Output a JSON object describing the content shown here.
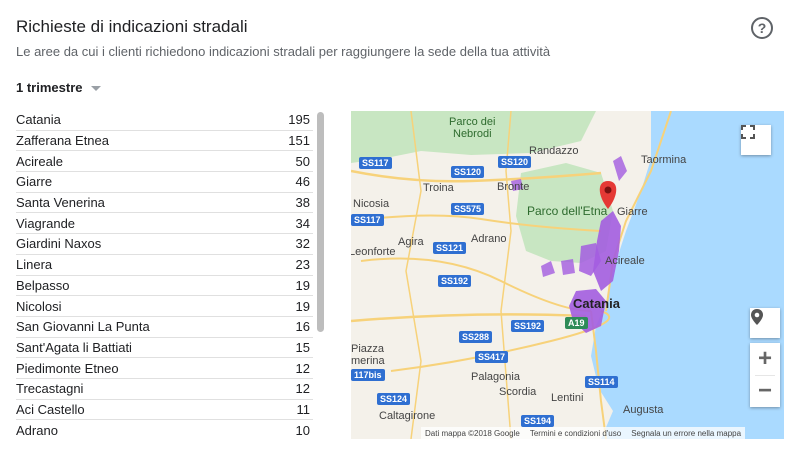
{
  "header": {
    "title": "Richieste di indicazioni stradali",
    "subtitle": "Le aree da cui i clienti richiedono indicazioni stradali per raggiungere la sede della tua attività",
    "help_icon": "?"
  },
  "filter": {
    "period_label": "1 trimestre"
  },
  "locations": [
    {
      "name": "Catania",
      "count": "195"
    },
    {
      "name": "Zafferana Etnea",
      "count": "151"
    },
    {
      "name": "Acireale",
      "count": "50"
    },
    {
      "name": "Giarre",
      "count": "46"
    },
    {
      "name": "Santa Venerina",
      "count": "38"
    },
    {
      "name": "Viagrande",
      "count": "34"
    },
    {
      "name": "Giardini Naxos",
      "count": "32"
    },
    {
      "name": "Linera",
      "count": "23"
    },
    {
      "name": "Belpasso",
      "count": "19"
    },
    {
      "name": "Nicolosi",
      "count": "19"
    },
    {
      "name": "San Giovanni La Punta",
      "count": "16"
    },
    {
      "name": "Sant'Agata li Battiati",
      "count": "15"
    },
    {
      "name": "Piedimonte Etneo",
      "count": "12"
    },
    {
      "name": "Trecastagni",
      "count": "12"
    },
    {
      "name": "Aci Castello",
      "count": "11"
    },
    {
      "name": "Adrano",
      "count": "10"
    }
  ],
  "map": {
    "labels": {
      "parco_nebrodi": "Parco dei",
      "parco_nebrodi_2": "Nebrodi",
      "randazzo": "Randazzo",
      "taormina": "Taormina",
      "troina": "Troina",
      "bronte": "Bronte",
      "nicosia": "Nicosia",
      "parco_etna": "Parco dell'Etna",
      "giarre": "Giarre",
      "agira": "Agira",
      "adrano": "Adrano",
      "leonforte": "Leonforte",
      "acireale": "Acireale",
      "catania": "Catania",
      "piazza": "Piazza",
      "armerina": "merina",
      "palagonia": "Palagonia",
      "scordia": "Scordia",
      "lentini": "Lentini",
      "augusta": "Augusta",
      "caltagirone": "Caltagirone"
    },
    "roads": {
      "ss117": "SS117",
      "ss120a": "SS120",
      "ss120b": "SS120",
      "ss575": "SS575",
      "ss117b": "SS117",
      "ss121": "SS121",
      "ss192a": "SS192",
      "ss192b": "SS192",
      "ss288": "SS288",
      "ss417": "SS417",
      "ss117bis": "117bis",
      "ss124": "SS124",
      "ss114": "SS114",
      "ss194": "SS194",
      "a19": "A19"
    },
    "attribution": {
      "data": "Dati mappa ©2018 Google",
      "terms": "Termini e condizioni d'uso",
      "report": "Segnala un errore nella mappa"
    },
    "zoom_in": "+",
    "zoom_out": "−"
  }
}
